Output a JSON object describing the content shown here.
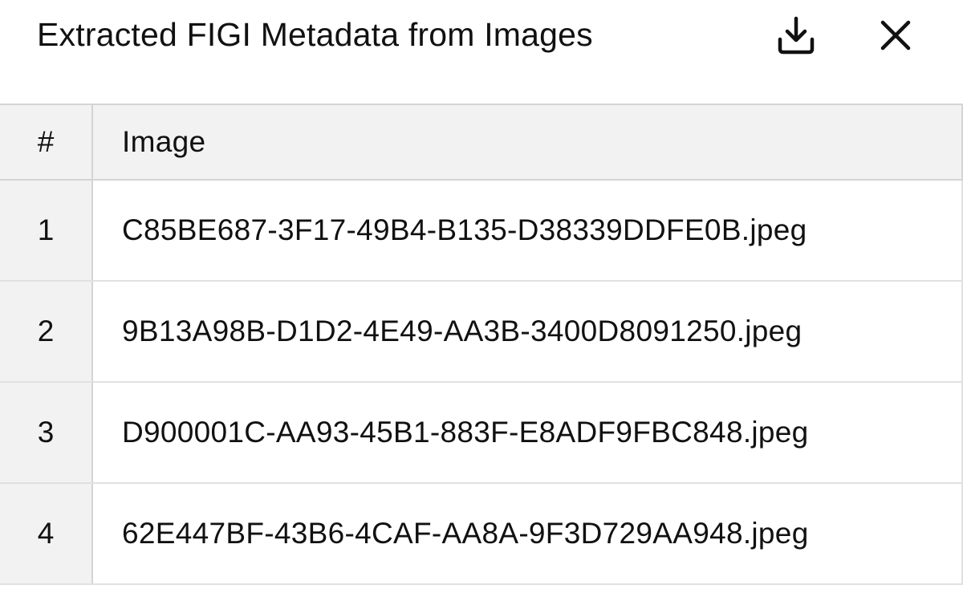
{
  "dialog": {
    "title": "Extracted FIGI Metadata from Images",
    "download_icon": "download-icon",
    "close_icon": "close-icon"
  },
  "table": {
    "columns": [
      "#",
      "Image"
    ],
    "rows": [
      {
        "num": "1",
        "image": "C85BE687-3F17-49B4-B135-D38339DDFE0B.jpeg"
      },
      {
        "num": "2",
        "image": "9B13A98B-D1D2-4E49-AA3B-3400D8091250.jpeg"
      },
      {
        "num": "3",
        "image": "D900001C-AA93-45B1-883F-E8ADF9FBC848.jpeg"
      },
      {
        "num": "4",
        "image": "62E447BF-43B6-4CAF-AA8A-9F3D729AA948.jpeg"
      }
    ]
  },
  "colors": {
    "header_bg": "#f2f2f2",
    "border": "#d4d4d4",
    "text": "#111111"
  }
}
